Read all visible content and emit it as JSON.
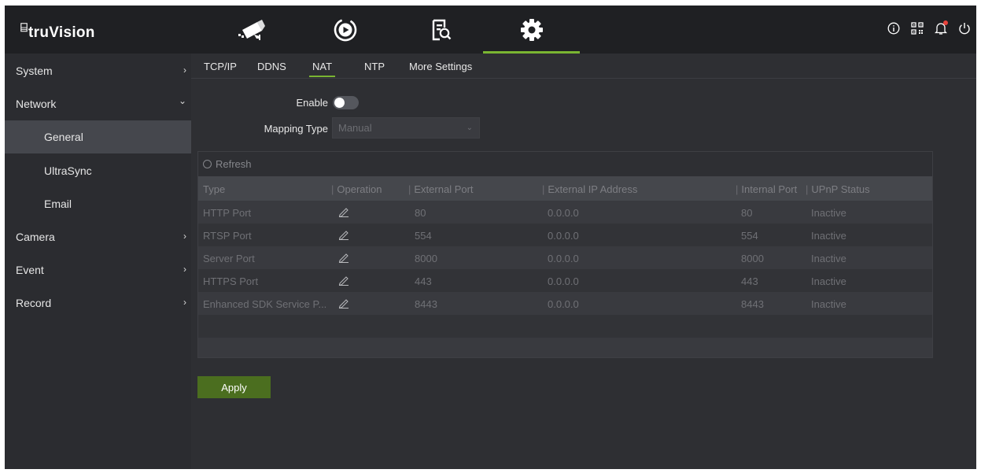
{
  "brand": {
    "mark": "⌸",
    "name": "truVision"
  },
  "top_nav": {
    "tabs": [
      {
        "icon": "camera-icon",
        "active": false
      },
      {
        "icon": "playback-icon",
        "active": false
      },
      {
        "icon": "search-file-icon",
        "active": false
      },
      {
        "icon": "settings-gear-icon",
        "active": true
      }
    ],
    "right_icons": [
      "info-icon",
      "qr-code-icon",
      "bell-icon",
      "power-icon"
    ]
  },
  "sidebar": {
    "items": [
      {
        "label": "System",
        "chevron": "›"
      },
      {
        "label": "Network",
        "chevron": "⌄",
        "expanded": true,
        "children": [
          {
            "label": "General",
            "active": true
          },
          {
            "label": "UltraSync"
          },
          {
            "label": "Email"
          }
        ]
      },
      {
        "label": "Camera",
        "chevron": "›"
      },
      {
        "label": "Event",
        "chevron": "›"
      },
      {
        "label": "Record",
        "chevron": "›"
      }
    ]
  },
  "subtabs": [
    {
      "label": "TCP/IP"
    },
    {
      "label": "DDNS"
    },
    {
      "label": "NAT",
      "active": true
    },
    {
      "label": "NTP"
    },
    {
      "label": "More Settings"
    }
  ],
  "form": {
    "enable_label": "Enable",
    "enable_on": false,
    "mapping_type_label": "Mapping Type",
    "mapping_type_value": "Manual",
    "caret": "⌄"
  },
  "table": {
    "refresh_label": "Refresh",
    "headers": [
      "Type",
      "Operation",
      "External Port",
      "External IP Address",
      "Internal Port",
      "UPnP Status"
    ],
    "rows": [
      {
        "type": "HTTP Port",
        "external_port": "80",
        "external_ip": "0.0.0.0",
        "internal_port": "80",
        "status": "Inactive"
      },
      {
        "type": "RTSP Port",
        "external_port": "554",
        "external_ip": "0.0.0.0",
        "internal_port": "554",
        "status": "Inactive"
      },
      {
        "type": "Server Port",
        "external_port": "8000",
        "external_ip": "0.0.0.0",
        "internal_port": "8000",
        "status": "Inactive"
      },
      {
        "type": "HTTPS Port",
        "external_port": "443",
        "external_ip": "0.0.0.0",
        "internal_port": "443",
        "status": "Inactive"
      },
      {
        "type": "Enhanced SDK Service P...",
        "external_port": "8443",
        "external_ip": "0.0.0.0",
        "internal_port": "8443",
        "status": "Inactive"
      }
    ]
  },
  "apply_label": "Apply",
  "colors": {
    "accent": "#7ab532",
    "apply_button": "#4b6e1f",
    "notification": "#e8423c"
  }
}
